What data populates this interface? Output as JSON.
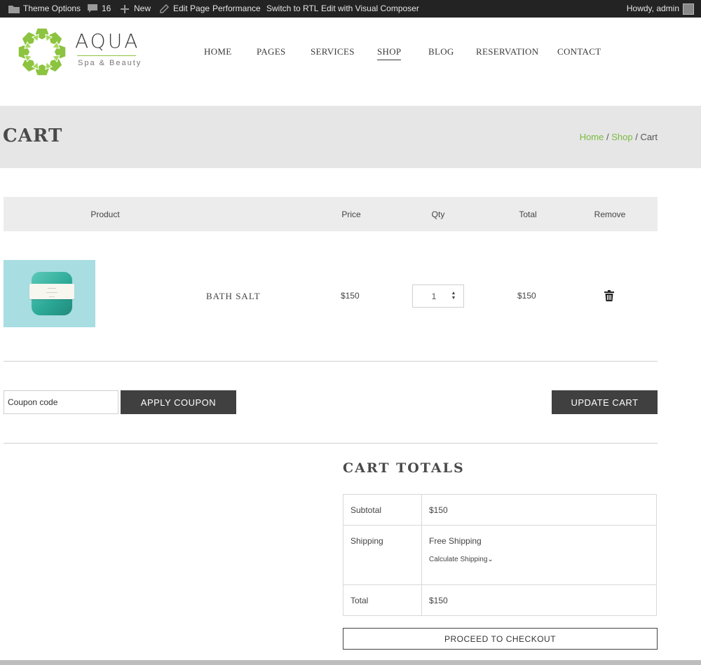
{
  "admin_bar": {
    "theme_options": "Theme Options",
    "comments_count": "16",
    "new_label": "New",
    "edit_page": "Edit Page",
    "performance": "Performance",
    "switch_rtl": "Switch to RTL",
    "visual_composer": "Edit with Visual Composer",
    "howdy": "Howdy, admin"
  },
  "logo": {
    "name": "AQUA",
    "tagline": "Spa & Beauty",
    "color": "#8cc33f"
  },
  "nav": {
    "items": [
      {
        "label": "HOME"
      },
      {
        "label": "PAGES"
      },
      {
        "label": "SERVICES"
      },
      {
        "label": "SHOP",
        "active": true
      },
      {
        "label": "BLOG"
      },
      {
        "label": "RESERVATION"
      },
      {
        "label": "CONTACT"
      }
    ]
  },
  "page": {
    "title": "CART",
    "breadcrumb": {
      "home": "Home",
      "sep1": " / ",
      "shop": "Shop",
      "sep2": " / ",
      "current": "Cart"
    }
  },
  "cart": {
    "headers": {
      "product": "Product",
      "price": "Price",
      "qty": "Qty",
      "total": "Total",
      "remove": "Remove"
    },
    "items": [
      {
        "name": "BATH SALT",
        "price": "$150",
        "qty": "1",
        "total": "$150",
        "image_icon": "soap-bar-product-image"
      }
    ],
    "coupon_placeholder": "Coupon code",
    "apply_coupon": "APPLY COUPON",
    "update_cart": "UPDATE CART"
  },
  "totals": {
    "title": "CART TOTALS",
    "subtotal_label": "Subtotal",
    "subtotal_value": "$150",
    "shipping_label": "Shipping",
    "shipping_value": "Free Shipping",
    "calculate_shipping": "Calculate Shipping",
    "total_label": "Total",
    "total_value": "$150",
    "checkout": "PROCEED TO CHECKOUT"
  },
  "colors": {
    "accent_green": "#7bbb41",
    "dark_button": "#404040",
    "admin_bar": "#232323"
  }
}
